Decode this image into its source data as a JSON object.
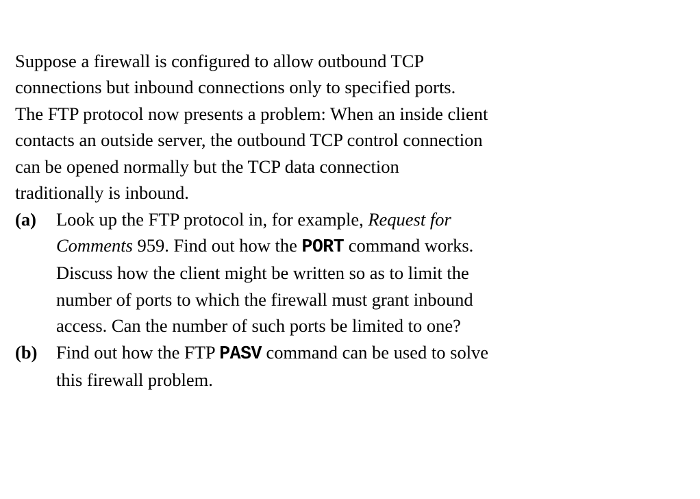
{
  "intro": {
    "l1": "Suppose a firewall is configured to allow outbound TCP",
    "l2": "connections but inbound connections only to specified ports.",
    "l3": "The FTP protocol now presents a problem: When an inside client",
    "l4": "contacts an outside server, the outbound TCP control connection",
    "l5": "can be opened normally but the TCP data connection",
    "l6": "traditionally is inbound."
  },
  "a": {
    "label": "(a)",
    "l1a": "Look up the FTP protocol in, for example, ",
    "l1b_italic": "Request for",
    "l2a_italic": "Comments",
    "l2b": " 959. Find out how the ",
    "l2c_mono": "PORT",
    "l2d": " command works.",
    "l3": "Discuss how the client might be written so as to limit the",
    "l4": "number of ports to which the firewall must grant inbound",
    "l5": "access. Can the number of such ports be limited to one?"
  },
  "b": {
    "label": "(b)",
    "l1a": "Find out how the FTP ",
    "l1b_mono": "PASV",
    "l1c": " command can be used to solve",
    "l2": "this firewall problem."
  }
}
